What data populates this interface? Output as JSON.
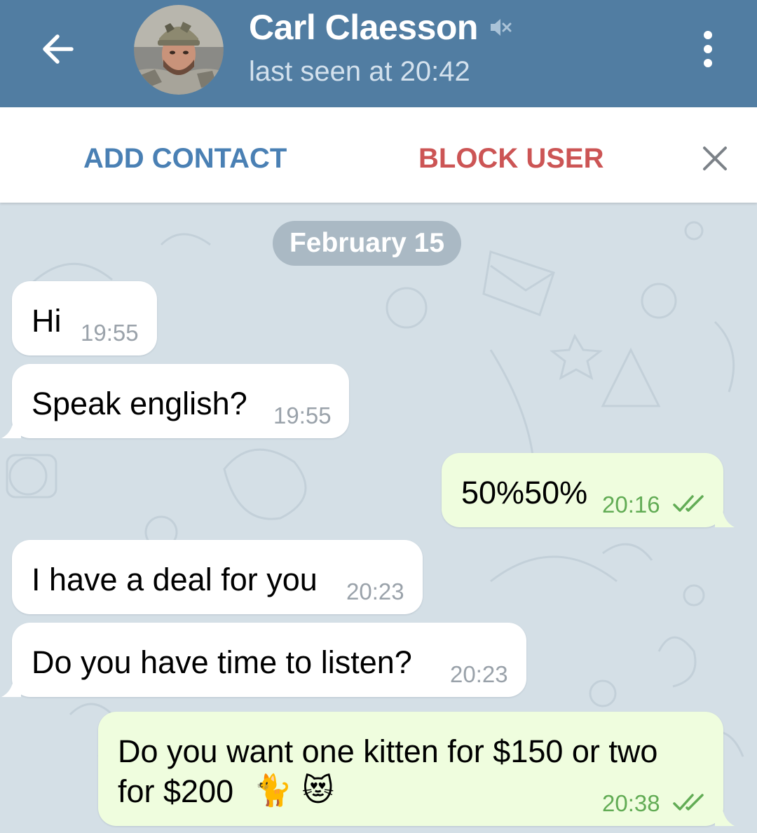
{
  "header": {
    "name": "Carl Claesson",
    "status": "last seen at 20:42",
    "icons": {
      "back": "arrow-left-icon",
      "mute": "speaker-muted-icon",
      "menu": "more-vertical-icon"
    }
  },
  "actionbar": {
    "add_contact": "ADD CONTACT",
    "block_user": "BLOCK USER",
    "close_icon": "close-icon"
  },
  "chat": {
    "date": "February 15",
    "messages": [
      {
        "direction": "in",
        "text": "Hi",
        "time": "19:55"
      },
      {
        "direction": "in",
        "text": "Speak english?",
        "time": "19:55"
      },
      {
        "direction": "out",
        "text": "50%50%",
        "time": "20:16",
        "status": "read"
      },
      {
        "direction": "in",
        "text": "I have a deal for you",
        "time": "20:23"
      },
      {
        "direction": "in",
        "text": "Do you have time to listen?",
        "time": "20:23"
      },
      {
        "direction": "out",
        "text_line1": "Do you want one kitten for $150 or two",
        "text_line2": "for $200",
        "emoji": "🐈 😻",
        "time": "20:38",
        "status": "read"
      }
    ]
  },
  "colors": {
    "header": "#517da2",
    "out_bubble": "#effdde",
    "in_bubble": "#ffffff",
    "chat_bg": "#d4dfe6",
    "block": "#cc5555",
    "add": "#4a80b4"
  }
}
